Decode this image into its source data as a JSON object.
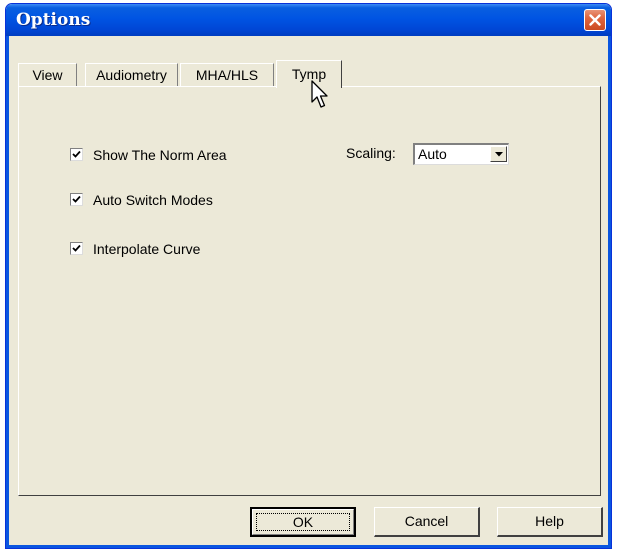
{
  "window": {
    "title": "Options",
    "close_icon": "close-icon"
  },
  "tabs": [
    {
      "label": "View",
      "active": false
    },
    {
      "label": "Audiometry",
      "active": false
    },
    {
      "label": "MHA/HLS",
      "active": false
    },
    {
      "label": "Tymp",
      "active": true
    }
  ],
  "panel": {
    "checkboxes": [
      {
        "label": "Show The Norm Area",
        "checked": true
      },
      {
        "label": "Auto Switch Modes",
        "checked": true
      },
      {
        "label": "Interpolate Curve",
        "checked": true
      }
    ],
    "scaling": {
      "label": "Scaling:",
      "value": "Auto"
    }
  },
  "buttons": {
    "ok": "OK",
    "cancel": "Cancel",
    "help": "Help"
  },
  "colors": {
    "titlebar": "#0054e3",
    "face": "#ece9d8",
    "close": "#e0663f"
  }
}
